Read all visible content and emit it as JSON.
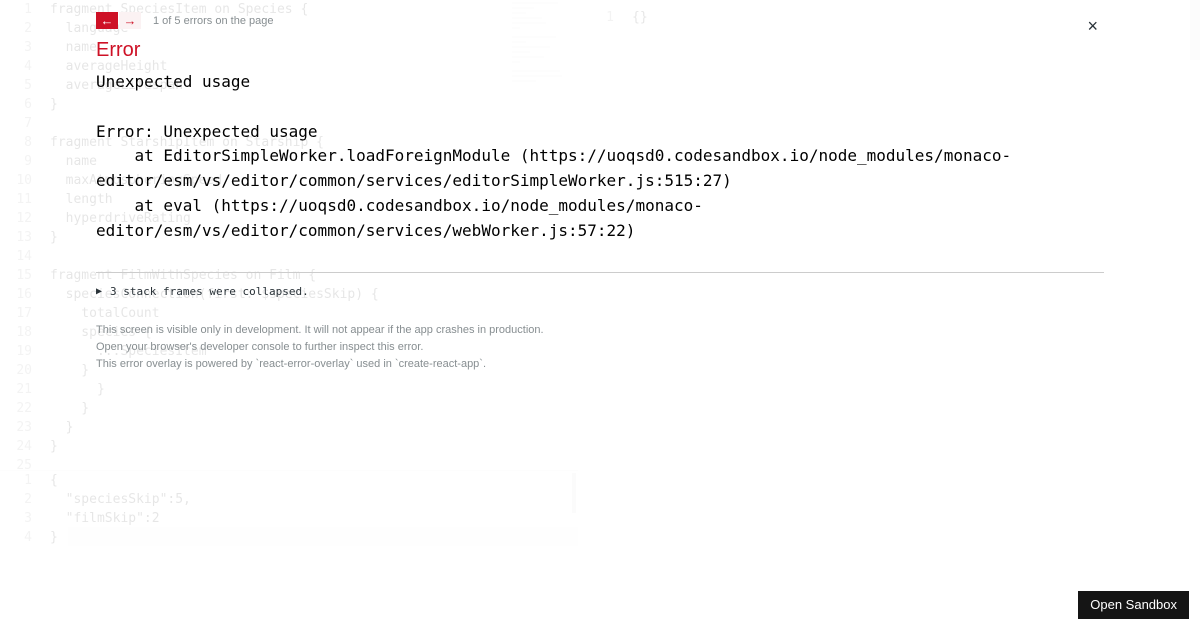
{
  "editor": {
    "main_lines": [
      "fragment SpeciesItem on Species {",
      "  language",
      "  name",
      "  averageHeight",
      "  averageLifespan",
      "}",
      "",
      "fragment StarshipItem on Starship {",
      "  name",
      "  maxAtmospheringSpeed",
      "  length",
      "  hyperdriveRating",
      "}",
      "",
      "fragment FilmWithSpecies on Film {",
      "  speciesConnection(first: $speciesSkip) {",
      "    totalCount",
      "    species {",
      "      ...SpeciesItem",
      "    }",
      "      }",
      "    }",
      "  }",
      "}",
      ""
    ],
    "vars_lines": [
      "{",
      "  \"speciesSkip\":5,",
      "  \"filmSkip\":2",
      "}"
    ]
  },
  "result": {
    "gutter": "1",
    "code": "{}"
  },
  "overlay": {
    "nav": {
      "prev": "←",
      "next": "→",
      "count_text": "1 of 5 errors on the page"
    },
    "close": "×",
    "title": "Error",
    "message": "Unexpected usage\n\nError: Unexpected usage\n    at EditorSimpleWorker.loadForeignModule (https://uoqsd0.codesandbox.io/node_modules/monaco-editor/esm/vs/editor/common/services/editorSimpleWorker.js:515:27)\n    at eval (https://uoqsd0.codesandbox.io/node_modules/monaco-editor/esm/vs/editor/common/services/webWorker.js:57:22)",
    "collapsed": {
      "icon": "▶",
      "text": "3 stack frames were collapsed."
    },
    "dev_notes": [
      "This screen is visible only in development. It will not appear if the app crashes in production.",
      "Open your browser's developer console to further inspect this error.",
      "This error overlay is powered by `react-error-overlay` used in `create-react-app`."
    ]
  },
  "sandbox_button": "Open Sandbox"
}
